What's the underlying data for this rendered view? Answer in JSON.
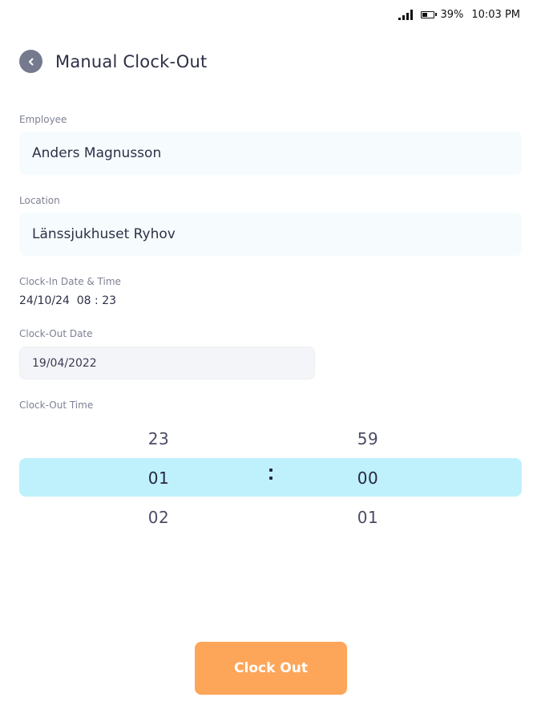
{
  "status_bar": {
    "battery": "39%",
    "time": "10:03 PM"
  },
  "header": {
    "title": "Manual Clock-Out",
    "back_icon": "chevron-left-icon"
  },
  "employee": {
    "label": "Employee",
    "value": "Anders Magnusson"
  },
  "location": {
    "label": "Location",
    "value": "Länssjukhuset Ryhov"
  },
  "clock_in": {
    "label": "Clock-In Date & Time",
    "value": "24/10/24  08 : 23"
  },
  "clock_out_date": {
    "label": "Clock-Out Date",
    "value": "19/04/2022"
  },
  "clock_out_time": {
    "label": "Clock-Out Time",
    "hours": {
      "prev": "23",
      "selected": "01",
      "next": "02"
    },
    "minutes": {
      "prev": "59",
      "selected": "00",
      "next": "01"
    }
  },
  "actions": {
    "clock_out_label": "Clock Out"
  },
  "colors": {
    "accent": "#fda65a",
    "picker_highlight": "#bff1fd",
    "field_background": "#f6fcfd"
  }
}
